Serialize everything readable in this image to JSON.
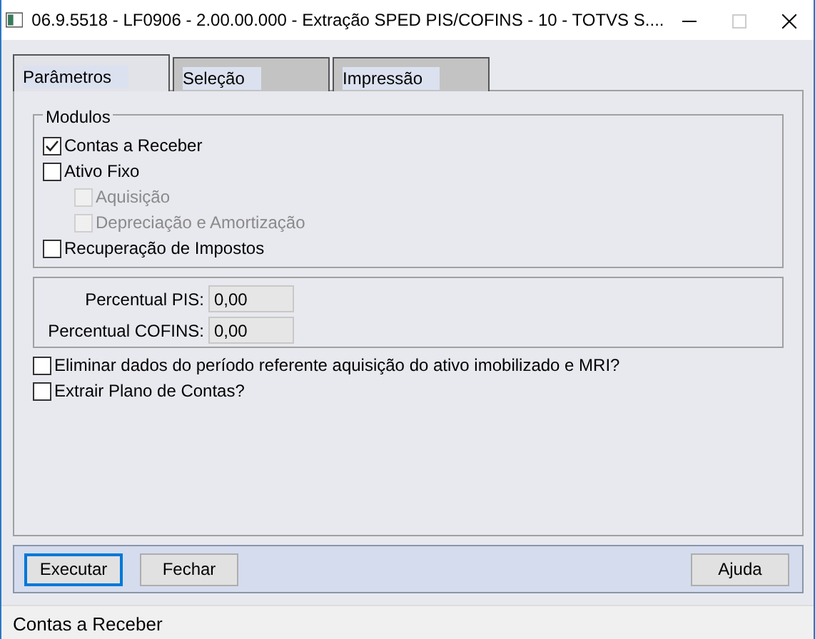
{
  "window": {
    "title": "06.9.5518 - LF0906 - 2.00.00.000 - Extração SPED PIS/COFINS - 10 - TOTVS S...."
  },
  "tabs": [
    {
      "label": "Parâmetros",
      "selected": true
    },
    {
      "label": "Seleção",
      "selected": false
    },
    {
      "label": "Impressão",
      "selected": false
    }
  ],
  "modules": {
    "title": "Modulos",
    "items": [
      {
        "label": "Contas a Receber",
        "checked": true,
        "disabled": false
      },
      {
        "label": "Ativo Fixo",
        "checked": false,
        "disabled": false,
        "children": [
          {
            "label": "Aquisição",
            "checked": false,
            "disabled": true
          },
          {
            "label": "Depreciação e Amortização",
            "checked": false,
            "disabled": true
          }
        ]
      },
      {
        "label": "Recuperação de Impostos",
        "checked": false,
        "disabled": false
      }
    ]
  },
  "percentages": [
    {
      "label": "Percentual PIS:",
      "value": "0,00"
    },
    {
      "label": "Percentual COFINS:",
      "value": "0,00"
    }
  ],
  "options": [
    {
      "label": "Eliminar dados do período referente aquisição do ativo imobilizado e MRI?",
      "checked": false
    },
    {
      "label": "Extrair Plano de Contas?",
      "checked": false
    }
  ],
  "buttons": [
    {
      "label": "Executar",
      "focused": true
    },
    {
      "label": "Fechar",
      "focused": false
    },
    {
      "label": "Ajuda",
      "focused": false
    }
  ],
  "status_bar": "Contas a Receber"
}
